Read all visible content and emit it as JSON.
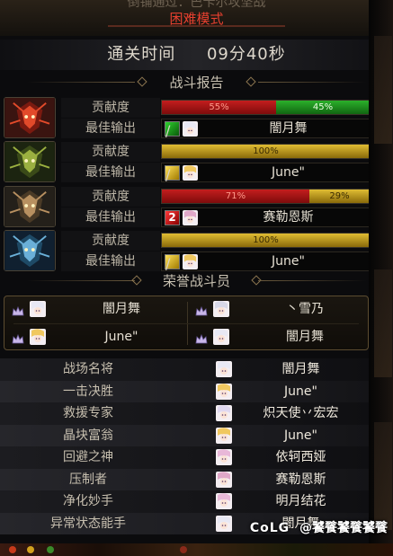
{
  "header": {
    "faded_text": "倒铺通过：巴卡尔攻坚战",
    "mode": "困难模式"
  },
  "clear_time": {
    "label": "通关时间",
    "value": "09分40秒"
  },
  "sections": {
    "battle_report": "战斗报告",
    "honor": "荣誉战斗员"
  },
  "labels": {
    "contribution": "贡献度",
    "best_output": "最佳输出"
  },
  "colors": {
    "mode_red": "#e7402f",
    "bar_red": "#c41e1e",
    "bar_green": "#2bb12b",
    "bar_gold": "#e0bd33"
  },
  "players": [
    {
      "portrait_icon": "fire-dragon-portrait",
      "segments": [
        {
          "text": "55%",
          "percent": 55,
          "color": "red"
        },
        {
          "text": "45%",
          "percent": 45,
          "color": "green"
        }
      ],
      "best_skill": "green",
      "best_skill_text": "/",
      "best_name": "闇月舞"
    },
    {
      "portrait_icon": "earth-dragon-portrait",
      "segments": [
        {
          "text": "100%",
          "percent": 100,
          "color": "gold"
        }
      ],
      "best_skill": "yellow",
      "best_skill_text": "/",
      "best_name": "June\""
    },
    {
      "portrait_icon": "dark-dragon-portrait",
      "segments": [
        {
          "text": "71%",
          "percent": 71,
          "color": "red"
        },
        {
          "text": "29%",
          "percent": 29,
          "color": "gold"
        }
      ],
      "best_skill": "red",
      "best_skill_text": "2",
      "best_name": "赛勒恩斯"
    },
    {
      "portrait_icon": "ice-dragon-portrait",
      "segments": [
        {
          "text": "100%",
          "percent": 100,
          "color": "gold"
        }
      ],
      "best_skill": "yellow",
      "best_skill_text": "/",
      "best_name": "June\""
    }
  ],
  "honor_members": [
    {
      "name": "闇月舞"
    },
    {
      "name": "丶雪乃"
    },
    {
      "name": "June\""
    },
    {
      "name": "闇月舞"
    }
  ],
  "awards": [
    {
      "title": "战场名将",
      "name": "闇月舞"
    },
    {
      "title": "一击决胜",
      "name": "June\""
    },
    {
      "title": "救援专家",
      "name": "炽天使丷宏宏"
    },
    {
      "title": "晶块富翁",
      "name": "June\""
    },
    {
      "title": "回避之神",
      "name": "依轲西娅"
    },
    {
      "title": "压制者",
      "name": "赛勒恩斯"
    },
    {
      "title": "净化妙手",
      "name": "明月结花"
    },
    {
      "title": "异常状态能手",
      "name": "闇月舞"
    }
  ],
  "watermark": {
    "logo": "CoLG",
    "text": "@饕餮饕餮饕餮"
  }
}
